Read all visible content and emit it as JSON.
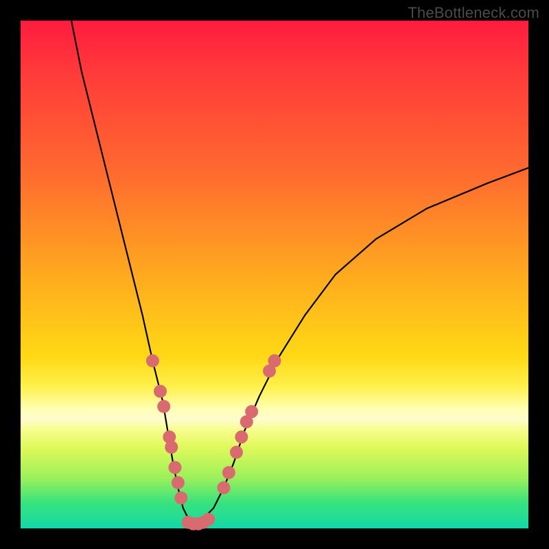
{
  "watermark": "TheBottleneck.com",
  "colors": {
    "curve_stroke": "#000000",
    "marker_fill": "#d96a6f",
    "marker_stroke": "#d96a6f",
    "background": "#000000"
  },
  "chart_data": {
    "type": "line",
    "title": "",
    "xlabel": "",
    "ylabel": "",
    "xlim": [
      0,
      100
    ],
    "ylim": [
      0,
      100
    ],
    "series": [
      {
        "name": "bottleneck-curve",
        "x": [
          10,
          12,
          15,
          18,
          21,
          24,
          26,
          28,
          29,
          30,
          31,
          32,
          33,
          34,
          35,
          36,
          38,
          40,
          42,
          44,
          47,
          51,
          56,
          62,
          70,
          80,
          92,
          100
        ],
        "values": [
          100,
          90,
          78,
          66,
          54,
          42,
          33,
          25,
          19,
          13,
          8,
          4,
          2,
          1,
          1,
          2,
          4,
          8,
          13,
          19,
          26,
          34,
          42,
          50,
          57,
          63,
          68,
          71
        ]
      }
    ],
    "markers": [
      {
        "name": "left-cluster",
        "x": 26.0,
        "y": 33
      },
      {
        "name": "left-cluster",
        "x": 27.5,
        "y": 27
      },
      {
        "name": "left-cluster",
        "x": 28.2,
        "y": 24
      },
      {
        "name": "left-cluster",
        "x": 29.3,
        "y": 18
      },
      {
        "name": "left-cluster",
        "x": 29.7,
        "y": 16
      },
      {
        "name": "left-cluster",
        "x": 30.4,
        "y": 12
      },
      {
        "name": "left-cluster",
        "x": 31.0,
        "y": 9
      },
      {
        "name": "left-cluster",
        "x": 31.6,
        "y": 6
      },
      {
        "name": "bottom",
        "x": 33.0,
        "y": 1.2
      },
      {
        "name": "bottom",
        "x": 34.0,
        "y": 0.9
      },
      {
        "name": "bottom",
        "x": 35.0,
        "y": 0.9
      },
      {
        "name": "bottom",
        "x": 36.0,
        "y": 1.2
      },
      {
        "name": "bottom",
        "x": 37.0,
        "y": 1.8
      },
      {
        "name": "right-cluster",
        "x": 40.0,
        "y": 8
      },
      {
        "name": "right-cluster",
        "x": 41.0,
        "y": 11
      },
      {
        "name": "right-cluster",
        "x": 42.5,
        "y": 15
      },
      {
        "name": "right-cluster",
        "x": 43.5,
        "y": 18
      },
      {
        "name": "right-cluster",
        "x": 44.5,
        "y": 21
      },
      {
        "name": "right-cluster",
        "x": 45.5,
        "y": 23
      },
      {
        "name": "right-cluster",
        "x": 49.0,
        "y": 31
      },
      {
        "name": "right-cluster",
        "x": 50.0,
        "y": 33
      }
    ]
  }
}
